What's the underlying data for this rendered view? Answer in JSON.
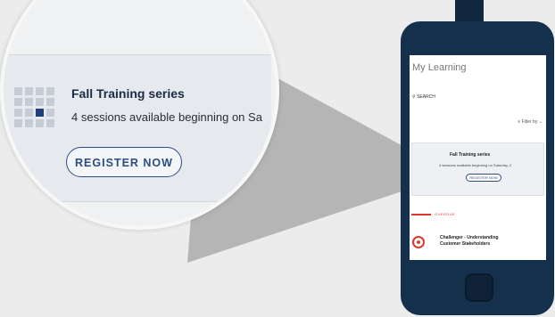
{
  "magnified": {
    "card_title": "Fall Training series",
    "card_subtitle": "4 sessions available beginning on Sa",
    "register_label": "REGISTER NOW"
  },
  "phone_screen": {
    "page_title": "My Learning",
    "search_label": "SEARCH",
    "filter_label": "Filter by",
    "card_title": "Fall Training series",
    "card_subtitle": "4 sessions available beginning on Saturday, 2",
    "register_label": "REGISTER NOW",
    "section_label": "OVERDUE",
    "course_title": "Challenger - Understanding Customer Stakeholders"
  },
  "colors": {
    "accent": "#2c4d80",
    "phone_body": "#14304d",
    "overdue": "#d93a2c"
  }
}
